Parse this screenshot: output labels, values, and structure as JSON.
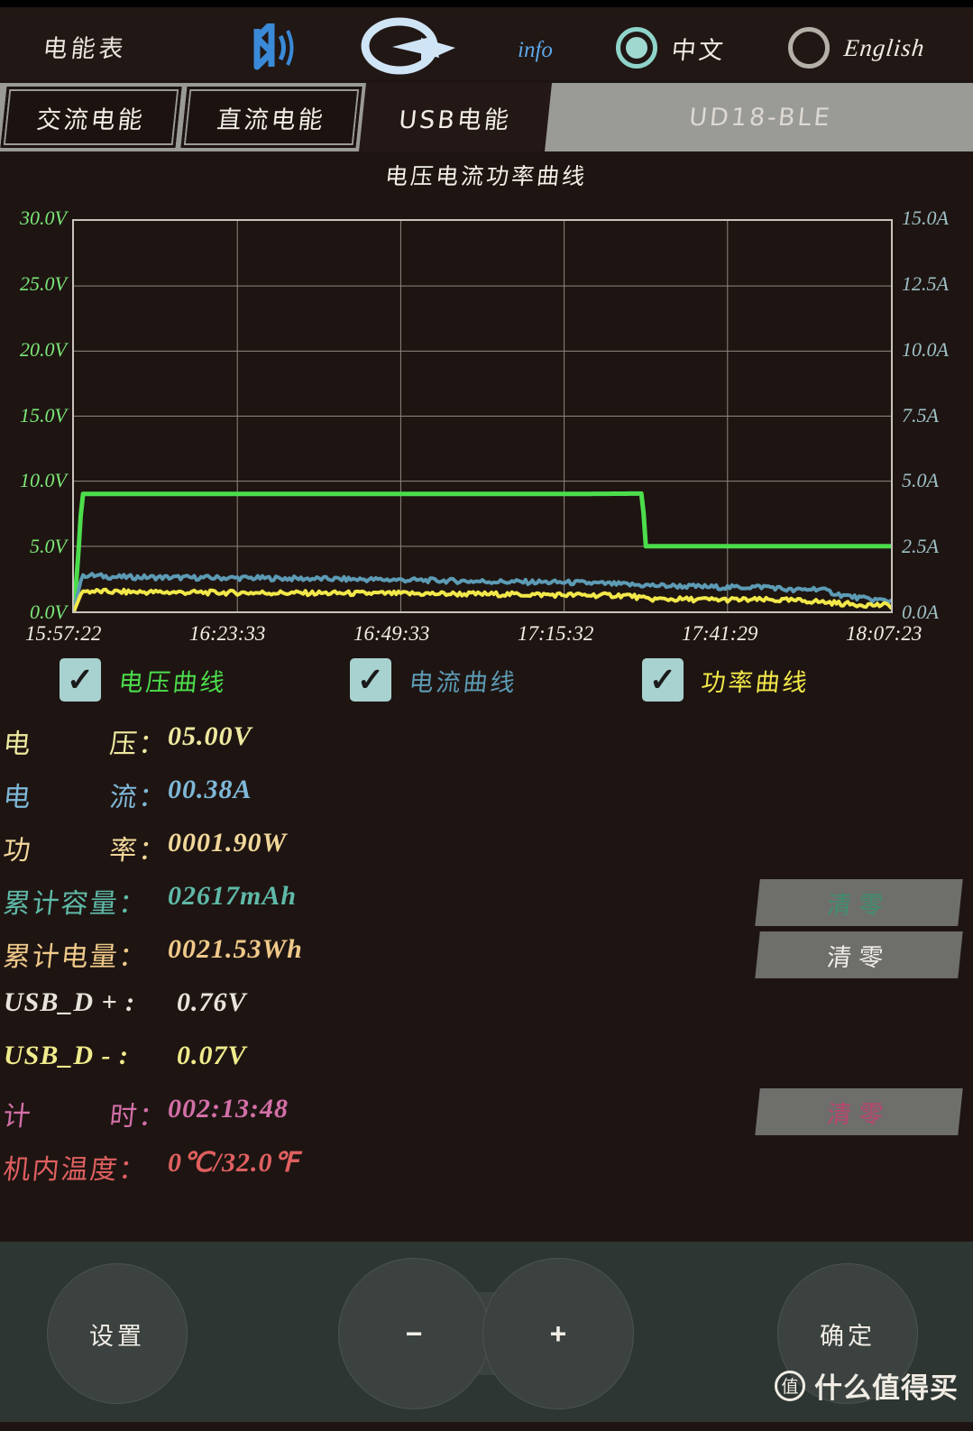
{
  "header": {
    "app_title": "电能表",
    "bluetooth_icon": "bluetooth-icon",
    "refresh_icon": "refresh-icon",
    "info_label": "info",
    "lang_cn_label": "中文",
    "lang_en_label": "English",
    "lang_selected": "中文"
  },
  "tabs": [
    {
      "label": "交流电能",
      "active": false
    },
    {
      "label": "直流电能",
      "active": false
    },
    {
      "label": "USB电能",
      "active": true
    },
    {
      "label": "UD18-BLE",
      "active": false
    }
  ],
  "chart_data": {
    "type": "line",
    "title": "电压电流功率曲线",
    "xlabel": "",
    "ylabel": "",
    "grid": true,
    "left_axis": {
      "unit": "V",
      "ticks": [
        "30.0V",
        "25.0V",
        "20.0V",
        "15.0V",
        "10.0V",
        "5.0V",
        "0.0V"
      ],
      "values": [
        30.0,
        25.0,
        20.0,
        15.0,
        10.0,
        5.0,
        0.0
      ],
      "ylim": [
        0,
        30
      ],
      "color": "#7ce878"
    },
    "right_axis": {
      "unit": "A",
      "ticks": [
        "15.0A",
        "12.5A",
        "10.0A",
        "7.5A",
        "5.0A",
        "2.5A",
        "0.0A"
      ],
      "values": [
        15.0,
        12.5,
        10.0,
        7.5,
        5.0,
        2.5,
        0.0
      ],
      "ylim": [
        0,
        15
      ],
      "color": "#9ec0c6"
    },
    "x_ticks": [
      "15:57:22",
      "16:23:33",
      "16:49:33",
      "17:15:32",
      "17:41:29",
      "18:07:23"
    ],
    "series": [
      {
        "name": "电压曲线",
        "axis": "left",
        "unit": "V",
        "color": "#4cdd4c",
        "x_frac": [
          0.0,
          0.005,
          0.01,
          0.2,
          0.4,
          0.6,
          0.695,
          0.698,
          0.7,
          0.8,
          0.9,
          1.0
        ],
        "values": [
          0.0,
          4.0,
          9.02,
          9.02,
          9.02,
          9.02,
          9.05,
          7.0,
          5.0,
          5.0,
          5.0,
          5.0
        ]
      },
      {
        "name": "电流曲线",
        "axis": "right",
        "unit": "A",
        "color": "#5d9bb5",
        "x_frac": [
          0.0,
          0.01,
          0.05,
          0.12,
          0.22,
          0.3,
          0.38,
          0.45,
          0.52,
          0.58,
          0.62,
          0.66,
          0.7,
          0.74,
          0.8,
          0.85,
          0.88,
          0.91,
          0.94,
          0.97,
          1.0
        ],
        "values": [
          0.0,
          1.4,
          1.32,
          1.3,
          1.28,
          1.25,
          1.22,
          1.18,
          1.14,
          1.12,
          1.1,
          1.05,
          1.0,
          0.97,
          0.92,
          0.95,
          0.8,
          0.88,
          0.62,
          0.48,
          0.4
        ]
      },
      {
        "name": "功率曲线",
        "axis": "left",
        "unit": "W",
        "color": "#f2e84a",
        "x_frac": [
          0.0,
          0.01,
          0.05,
          0.15,
          0.3,
          0.45,
          0.55,
          0.62,
          0.68,
          0.7,
          0.78,
          0.85,
          0.9,
          0.95,
          1.0
        ],
        "values": [
          0.0,
          1.55,
          1.5,
          1.45,
          1.4,
          1.35,
          1.3,
          1.25,
          1.22,
          0.95,
          0.9,
          0.88,
          0.8,
          0.55,
          0.45
        ]
      }
    ]
  },
  "legend": [
    {
      "label": "电压曲线",
      "color": "#4cdd4c",
      "checked": true,
      "check_glyph": "✓"
    },
    {
      "label": "电流曲线",
      "color": "#5d9bb5",
      "checked": true,
      "check_glyph": "✓"
    },
    {
      "label": "功率曲线",
      "color": "#f2e84a",
      "checked": true,
      "check_glyph": "✓"
    }
  ],
  "readings": [
    {
      "label": "电        压：",
      "label_a": "电",
      "label_b": "压：",
      "value": "05.00V",
      "color": "#efe9a0"
    },
    {
      "label": "电        流：",
      "label_a": "电",
      "label_b": "流：",
      "value": "00.38A",
      "color": "#7fb8d8"
    },
    {
      "label": "功        率：",
      "label_a": "功",
      "label_b": "率：",
      "value": "0001.90W",
      "color": "#f2d79a"
    },
    {
      "label": "累计容量：",
      "value": "02617mAh",
      "color": "#5fb9a8"
    },
    {
      "label": "累计电量：",
      "value": "0021.53Wh",
      "color": "#f0c98a"
    },
    {
      "label": "USB_D + :",
      "value": "0.76V",
      "color": "#e8e4dc",
      "latin": true
    },
    {
      "label": "USB_D - :",
      "value": "0.07V",
      "color": "#f0eb8c",
      "latin": true
    },
    {
      "label": "计        时：",
      "label_a": "计",
      "label_b": "时：",
      "value": "002:13:48",
      "color": "#d36fa8"
    },
    {
      "label": "机内温度：",
      "value": "0℃/32.0℉",
      "color": "#e06060"
    }
  ],
  "clear_buttons": [
    {
      "label": "清零",
      "color": "#3f8f6f"
    },
    {
      "label": "清零",
      "color": "#f2eee7"
    },
    {
      "label": "清零",
      "color": "#b8456f"
    }
  ],
  "bottom_controls": {
    "settings_label": "设置",
    "minus_label": "−",
    "plus_label": "+",
    "confirm_label": "确定"
  },
  "watermark": {
    "badge": "值",
    "text": "什么值得买"
  }
}
